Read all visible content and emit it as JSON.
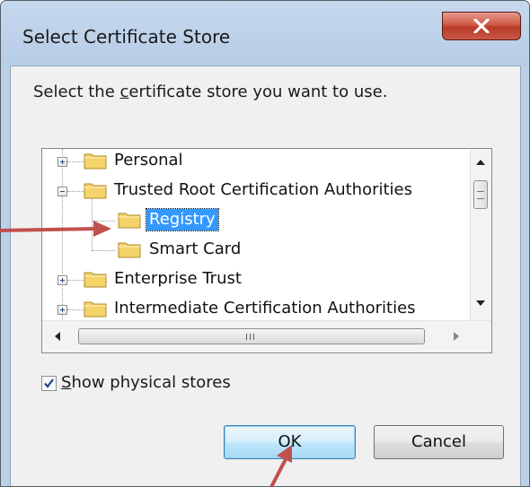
{
  "window": {
    "title": "Select Certificate Store",
    "close_glyph": "X"
  },
  "dialog": {
    "prompt_before": "Select the ",
    "prompt_underlined": "c",
    "prompt_after": "ertificate store you want to use."
  },
  "tree": {
    "items": [
      {
        "label": "Personal",
        "expanded": false,
        "selected": false
      },
      {
        "label": "Trusted Root Certification Authorities",
        "expanded": true,
        "selected": false
      },
      {
        "label": "Registry",
        "expanded": null,
        "selected": true
      },
      {
        "label": "Smart Card",
        "expanded": null,
        "selected": false
      },
      {
        "label": "Enterprise Trust",
        "expanded": false,
        "selected": false
      },
      {
        "label": "Intermediate Certification Authorities",
        "expanded": false,
        "selected": false
      }
    ],
    "hscroll_grip": "III"
  },
  "checkbox": {
    "label_underlined": "S",
    "label_rest": "how physical stores",
    "checked": true
  },
  "buttons": {
    "ok": "OK",
    "cancel": "Cancel"
  },
  "colors": {
    "selection": "#3399ff",
    "annotation_arrow": "#c0504d",
    "folder": "#f4d36b"
  },
  "icons": {
    "folder": "folder-icon",
    "expander": "tree-expander-icon",
    "close": "close-icon",
    "check": "checkmark-icon"
  }
}
